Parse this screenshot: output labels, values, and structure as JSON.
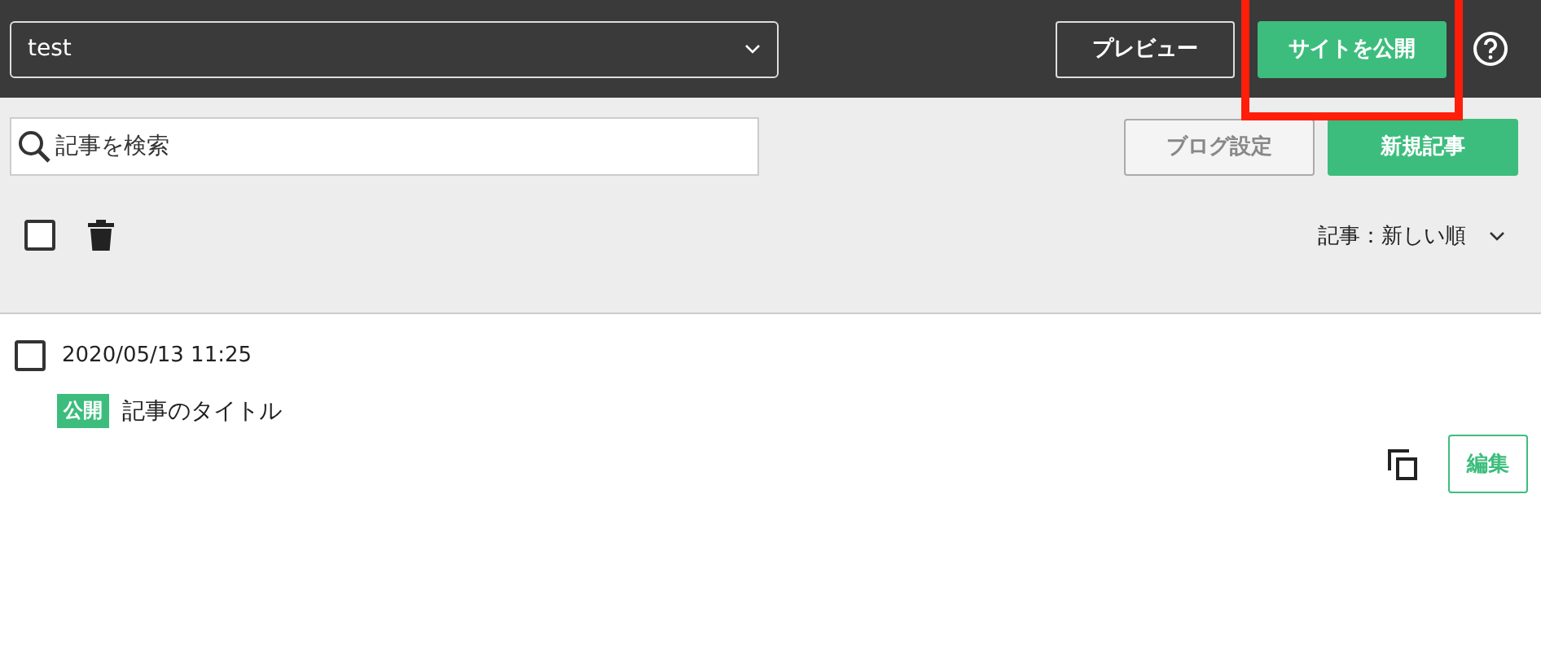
{
  "header": {
    "site_select": {
      "value": "test"
    },
    "preview_button": "プレビュー",
    "publish_button": "サイトを公開"
  },
  "toolbar": {
    "search": {
      "placeholder": "記事を検索"
    },
    "blog_settings_button": "ブログ設定",
    "new_post_button": "新規記事",
    "select_all": {
      "checked": false
    },
    "sort": {
      "value": "記事：新しい順"
    }
  },
  "articles": [
    {
      "checked": false,
      "date": "2020/05/13 11:25",
      "status": "公開",
      "title": "記事のタイトル",
      "edit_button": "編集"
    }
  ]
}
